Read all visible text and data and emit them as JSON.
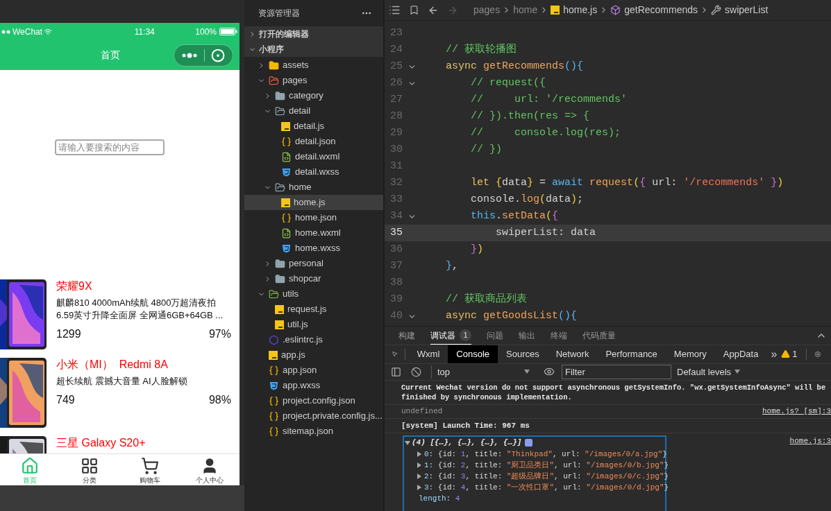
{
  "phone": {
    "status_bar": {
      "carrier": "WeChat",
      "time": "11:34",
      "battery": "100%"
    },
    "nav_title": "首页",
    "search": {
      "placeholder": "请输入要搜索的内容"
    },
    "products": [
      {
        "name": "荣耀9X",
        "description": "麒麟810 4000mAh续航 4800万超清夜拍 6.59英寸升降全面屏 全网通6GB+64GB ...",
        "price": "1299",
        "rate": "97%"
      },
      {
        "name": "小米（MI）  Redmi 8A",
        "description": "超长续航 震撼大音量 AI人脸解锁",
        "price": "749",
        "rate": "98%"
      },
      {
        "name": "三星 Galaxy S20+"
      }
    ],
    "tab_bar": [
      {
        "label": "首页",
        "selected": true
      },
      {
        "label": "分类",
        "selected": false
      },
      {
        "label": "购物车",
        "selected": false
      },
      {
        "label": "个人中心",
        "selected": false
      }
    ]
  },
  "explorer": {
    "title": "资源管理器",
    "sections": [
      {
        "label": "打开的编辑器",
        "expanded": false
      },
      {
        "label": "小程序",
        "expanded": true
      }
    ],
    "tree": [
      {
        "label": "assets",
        "kind": "assets",
        "expanded": false,
        "selected": false
      },
      {
        "label": "pages",
        "kind": "pages",
        "expanded": true,
        "selected": false,
        "children": [
          {
            "label": "category",
            "kind": "folder",
            "expanded": false,
            "selected": false
          },
          {
            "label": "detail",
            "kind": "folder",
            "expanded": true,
            "selected": false,
            "children": [
              {
                "label": "detail.js",
                "kind": "js",
                "selected": false
              },
              {
                "label": "detail.json",
                "kind": "json",
                "selected": false
              },
              {
                "label": "detail.wxml",
                "kind": "wxml",
                "selected": false
              },
              {
                "label": "detail.wxss",
                "kind": "wxss",
                "selected": false
              }
            ]
          },
          {
            "label": "home",
            "kind": "folder",
            "expanded": true,
            "selected": false,
            "children": [
              {
                "label": "home.js",
                "kind": "js",
                "selected": true
              },
              {
                "label": "home.json",
                "kind": "json",
                "selected": false
              },
              {
                "label": "home.wxml",
                "kind": "wxml",
                "selected": false
              },
              {
                "label": "home.wxss",
                "kind": "wxss",
                "selected": false
              }
            ]
          },
          {
            "label": "personal",
            "kind": "folder",
            "expanded": false,
            "selected": false
          },
          {
            "label": "shopcar",
            "kind": "folder",
            "expanded": false,
            "selected": false
          }
        ]
      },
      {
        "label": "utils",
        "kind": "utils",
        "expanded": true,
        "selected": false,
        "children": [
          {
            "label": "request.js",
            "kind": "js",
            "selected": false
          },
          {
            "label": "util.js",
            "kind": "js",
            "selected": false
          }
        ]
      },
      {
        "label": ".eslintrc.js",
        "kind": "eslint",
        "selected": false
      },
      {
        "label": "app.js",
        "kind": "js",
        "selected": false
      },
      {
        "label": "app.json",
        "kind": "json",
        "selected": false
      },
      {
        "label": "app.wxss",
        "kind": "wxss",
        "selected": false
      },
      {
        "label": "project.config.json",
        "kind": "json",
        "selected": false
      },
      {
        "label": "project.private.config.js...",
        "kind": "json",
        "selected": false
      },
      {
        "label": "sitemap.json",
        "kind": "json",
        "selected": false
      }
    ]
  },
  "editor": {
    "breadcrumb": [
      {
        "label": "pages"
      },
      {
        "label": "home"
      },
      {
        "label": "home.js",
        "kind": "js"
      },
      {
        "label": "getRecommends",
        "kind": "cube"
      },
      {
        "label": "swiperList",
        "kind": "wrench"
      }
    ],
    "lines": [
      {
        "no": "23",
        "fold": false,
        "current": false
      },
      {
        "no": "24",
        "fold": false,
        "current": false,
        "tokens": [
          {
            "text": "    // 获取轮播图",
            "kind": "comment"
          }
        ]
      },
      {
        "no": "25",
        "fold": true,
        "current": false,
        "tokens": [
          {
            "text": "    async",
            "kind": "keyword"
          },
          {
            "text": " getRecommends",
            "kind": "function"
          },
          {
            "text": "(){",
            "kind": "bracket3"
          }
        ]
      },
      {
        "no": "26",
        "fold": true,
        "current": false,
        "tokens": [
          {
            "text": "        // request({",
            "kind": "comment"
          }
        ]
      },
      {
        "no": "27",
        "fold": false,
        "current": false,
        "tokens": [
          {
            "text": "        //     url: '/recommends'",
            "kind": "comment"
          }
        ]
      },
      {
        "no": "28",
        "fold": false,
        "current": false,
        "tokens": [
          {
            "text": "        // }).then(res => {",
            "kind": "comment"
          }
        ]
      },
      {
        "no": "29",
        "fold": false,
        "current": false,
        "tokens": [
          {
            "text": "        //     console.log(res);",
            "kind": "comment"
          }
        ]
      },
      {
        "no": "30",
        "fold": false,
        "current": false,
        "tokens": [
          {
            "text": "        // })",
            "kind": "comment"
          }
        ]
      },
      {
        "no": "31",
        "fold": false,
        "current": false
      },
      {
        "no": "32",
        "fold": false,
        "current": false,
        "tokens": [
          {
            "text": "        let",
            "kind": "keyword"
          },
          {
            "text": " {",
            "kind": "bracket1"
          },
          {
            "text": "data",
            "kind": "text"
          },
          {
            "text": "}",
            "kind": "bracket1"
          },
          {
            "text": " = ",
            "kind": "text"
          },
          {
            "text": "await",
            "kind": "builtin"
          },
          {
            "text": " request",
            "kind": "function"
          },
          {
            "text": "(",
            "kind": "bracket1"
          },
          {
            "text": "{",
            "kind": "bracket2"
          },
          {
            "text": " url: ",
            "kind": "text"
          },
          {
            "text": "'/recommends'",
            "kind": "string"
          },
          {
            "text": " }",
            "kind": "bracket2"
          },
          {
            "text": ")",
            "kind": "bracket1"
          }
        ]
      },
      {
        "no": "33",
        "fold": false,
        "current": false,
        "tokens": [
          {
            "text": "        console.",
            "kind": "text"
          },
          {
            "text": "log",
            "kind": "function"
          },
          {
            "text": "(",
            "kind": "bracket1"
          },
          {
            "text": "data",
            "kind": "text"
          },
          {
            "text": ")",
            "kind": "bracket1"
          },
          {
            "text": ";",
            "kind": "text"
          }
        ]
      },
      {
        "no": "34",
        "fold": true,
        "current": false,
        "tokens": [
          {
            "text": "        this",
            "kind": "builtin"
          },
          {
            "text": ".",
            "kind": "text"
          },
          {
            "text": "setData",
            "kind": "function"
          },
          {
            "text": "(",
            "kind": "bracket1"
          },
          {
            "text": "{",
            "kind": "bracket2"
          }
        ]
      },
      {
        "no": "35",
        "fold": false,
        "current": true,
        "tokens": [
          {
            "text": "            swiperList: data",
            "kind": "text"
          }
        ]
      },
      {
        "no": "36",
        "fold": false,
        "current": false,
        "tokens": [
          {
            "text": "        }",
            "kind": "bracket2"
          },
          {
            "text": ")",
            "kind": "bracket1"
          }
        ]
      },
      {
        "no": "37",
        "fold": false,
        "current": false,
        "tokens": [
          {
            "text": "    }",
            "kind": "bracket3"
          },
          {
            "text": ",",
            "kind": "text"
          }
        ]
      },
      {
        "no": "38",
        "fold": false,
        "current": false
      },
      {
        "no": "39",
        "fold": false,
        "current": false,
        "tokens": [
          {
            "text": "    // 获取商品列表",
            "kind": "comment"
          }
        ]
      },
      {
        "no": "40",
        "fold": true,
        "current": false,
        "tokens": [
          {
            "text": "    async",
            "kind": "keyword"
          },
          {
            "text": " getGoodsList",
            "kind": "function"
          },
          {
            "text": "(){",
            "kind": "bracket3"
          }
        ]
      }
    ]
  },
  "panel": {
    "tabs": [
      {
        "label": "构建",
        "selected": false
      },
      {
        "label": "调试器",
        "selected": true,
        "badge": "1"
      },
      {
        "label": "问题",
        "selected": false
      },
      {
        "label": "输出",
        "selected": false
      },
      {
        "label": "终端",
        "selected": false
      },
      {
        "label": "代码质量",
        "selected": false
      }
    ],
    "devtools_tabs": [
      {
        "label": "Wxml",
        "selected": false
      },
      {
        "label": "Console",
        "selected": true
      },
      {
        "label": "Sources",
        "selected": false
      },
      {
        "label": "Network",
        "selected": false
      },
      {
        "label": "Performance",
        "selected": false
      },
      {
        "label": "Memory",
        "selected": false
      },
      {
        "label": "AppData",
        "selected": false
      }
    ],
    "more": "»",
    "warnings": "1",
    "context": "top",
    "filter": {
      "placeholder": "Filter"
    },
    "levels": "Default levels",
    "console": [
      {
        "kind": "message",
        "text": "Current Wechat version do not support asynchronous getSystemInfo. \"wx.getSystemInfoAsync\" will be finished by synchronous implementation."
      },
      {
        "kind": "log",
        "text": "undefined",
        "source": "home.js? [sm]:3"
      },
      {
        "kind": "system",
        "text": "[system] Launch Time: 967 ms"
      },
      {
        "kind": "group",
        "expanded": true,
        "text": "(4) [{…}, {…}, {…}, {…}]",
        "source": "home.js:3",
        "entries": [
          {
            "expandable": true,
            "tokens": [
              {
                "text": "0",
                "kind": "key"
              },
              {
                "text": ": {id: ",
                "kind": "text"
              },
              {
                "text": "1",
                "kind": "number"
              },
              {
                "text": ", title: ",
                "kind": "text"
              },
              {
                "text": "\"Thinkpad\"",
                "kind": "string"
              },
              {
                "text": ", url: ",
                "kind": "text"
              },
              {
                "text": "\"/images/0/a.jpg\"",
                "kind": "string"
              },
              {
                "text": "}",
                "kind": "text"
              }
            ]
          },
          {
            "expandable": true,
            "tokens": [
              {
                "text": "1",
                "kind": "key"
              },
              {
                "text": ": {id: ",
                "kind": "text"
              },
              {
                "text": "2",
                "kind": "number"
              },
              {
                "text": ", title: ",
                "kind": "text"
              },
              {
                "text": "\"厨卫品类日\"",
                "kind": "string"
              },
              {
                "text": ", url: ",
                "kind": "text"
              },
              {
                "text": "\"/images/0/b.jpg\"",
                "kind": "string"
              },
              {
                "text": "}",
                "kind": "text"
              }
            ]
          },
          {
            "expandable": true,
            "tokens": [
              {
                "text": "2",
                "kind": "key"
              },
              {
                "text": ": {id: ",
                "kind": "text"
              },
              {
                "text": "3",
                "kind": "number"
              },
              {
                "text": ", title: ",
                "kind": "text"
              },
              {
                "text": "\"超级品牌日\"",
                "kind": "string"
              },
              {
                "text": ", url: ",
                "kind": "text"
              },
              {
                "text": "\"/images/0/c.jpg\"",
                "kind": "string"
              },
              {
                "text": "}",
                "kind": "text"
              }
            ]
          },
          {
            "expandable": true,
            "tokens": [
              {
                "text": "3",
                "kind": "key"
              },
              {
                "text": ": {id: ",
                "kind": "text"
              },
              {
                "text": "4",
                "kind": "number"
              },
              {
                "text": ", title: ",
                "kind": "text"
              },
              {
                "text": "\"一次性口罩\"",
                "kind": "string"
              },
              {
                "text": ", url: ",
                "kind": "text"
              },
              {
                "text": "\"/images/0/d.jpg\"",
                "kind": "string"
              },
              {
                "text": "}",
                "kind": "text"
              }
            ]
          },
          {
            "expandable": false,
            "tokens": [
              {
                "text": "length",
                "kind": "key"
              },
              {
                "text": ": ",
                "kind": "text"
              },
              {
                "text": "4",
                "kind": "number"
              }
            ]
          }
        ]
      }
    ]
  }
}
